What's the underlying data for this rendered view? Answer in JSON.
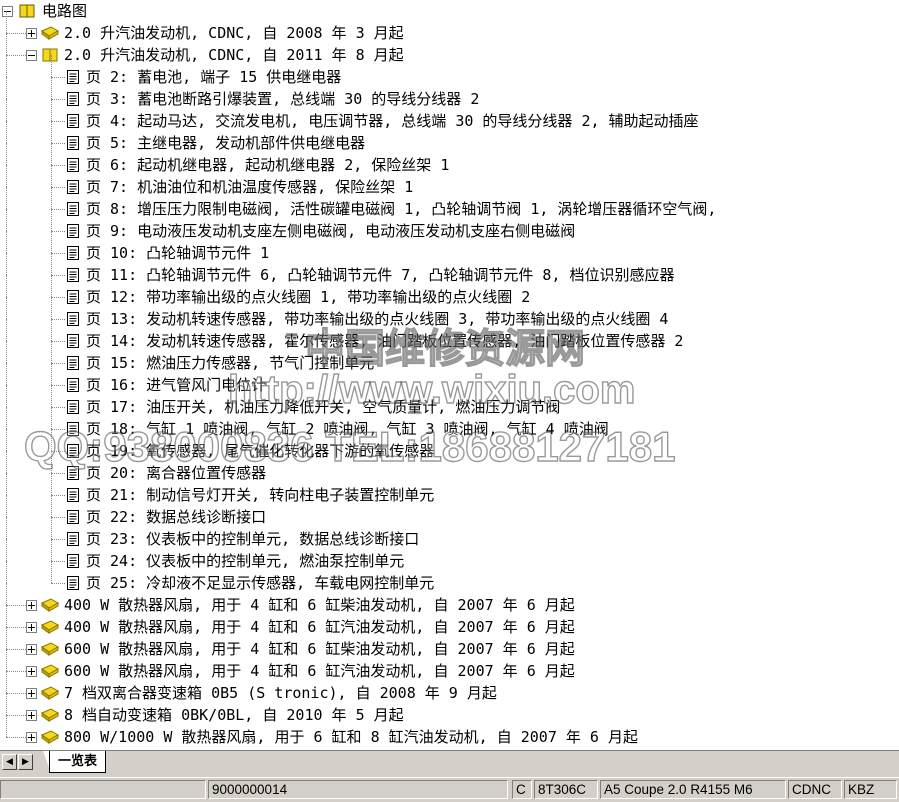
{
  "tree": {
    "root_label": "电路图",
    "items": [
      {
        "label": "2.0 升汽油发动机, CDNC, 自 2008 年 3 月起",
        "kind": "folder",
        "expanded": false,
        "level": 1
      },
      {
        "label": "2.0 升汽油发动机, CDNC, 自 2011 年 8 月起",
        "kind": "folder",
        "expanded": true,
        "level": 1
      },
      {
        "label": "页 2: 蓄电池, 端子 15 供电继电器",
        "kind": "page",
        "level": 2
      },
      {
        "label": "页 3: 蓄电池断路引爆装置, 总线端 30 的导线分线器 2",
        "kind": "page",
        "level": 2
      },
      {
        "label": "页 4: 起动马达, 交流发电机, 电压调节器, 总线端 30 的导线分线器 2, 辅助起动插座",
        "kind": "page",
        "level": 2
      },
      {
        "label": "页 5: 主继电器, 发动机部件供电继电器",
        "kind": "page",
        "level": 2
      },
      {
        "label": "页 6: 起动机继电器, 起动机继电器 2, 保险丝架 1",
        "kind": "page",
        "level": 2
      },
      {
        "label": "页 7: 机油油位和机油温度传感器, 保险丝架 1",
        "kind": "page",
        "level": 2
      },
      {
        "label": "页 8: 增压压力限制电磁阀, 活性碳罐电磁阀 1, 凸轮轴调节阀 1, 涡轮增压器循环空气阀,",
        "kind": "page",
        "level": 2
      },
      {
        "label": "页 9: 电动液压发动机支座左侧电磁阀, 电动液压发动机支座右侧电磁阀",
        "kind": "page",
        "level": 2
      },
      {
        "label": "页 10: 凸轮轴调节元件 1",
        "kind": "page",
        "level": 2
      },
      {
        "label": "页 11: 凸轮轴调节元件 6, 凸轮轴调节元件 7, 凸轮轴调节元件 8, 档位识别感应器",
        "kind": "page",
        "level": 2
      },
      {
        "label": "页 12: 带功率输出级的点火线圈 1, 带功率输出级的点火线圈 2",
        "kind": "page",
        "level": 2
      },
      {
        "label": "页 13: 发动机转速传感器, 带功率输出级的点火线圈 3, 带功率输出级的点火线圈 4",
        "kind": "page",
        "level": 2
      },
      {
        "label": "页 14: 发动机转速传感器, 霍尔传感器, 油门踏板位置传感器, 油门踏板位置传感器 2",
        "kind": "page",
        "level": 2
      },
      {
        "label": "页 15: 燃油压力传感器, 节气门控制单元",
        "kind": "page",
        "level": 2
      },
      {
        "label": "页 16: 进气管风门电位计",
        "kind": "page",
        "level": 2
      },
      {
        "label": "页 17: 油压开关, 机油压力降低开关, 空气质量计, 燃油压力调节阀",
        "kind": "page",
        "level": 2
      },
      {
        "label": "页 18: 气缸 1 喷油阀, 气缸 2 喷油阀, 气缸 3 喷油阀, 气缸 4 喷油阀",
        "kind": "page",
        "level": 2
      },
      {
        "label": "页 19: 氧传感器, 尾气催化转化器下游的氧传感器",
        "kind": "page",
        "level": 2
      },
      {
        "label": "页 20: 离合器位置传感器",
        "kind": "page",
        "level": 2
      },
      {
        "label": "页 21: 制动信号灯开关, 转向柱电子装置控制单元",
        "kind": "page",
        "level": 2
      },
      {
        "label": "页 22: 数据总线诊断接口",
        "kind": "page",
        "level": 2
      },
      {
        "label": "页 23: 仪表板中的控制单元, 数据总线诊断接口",
        "kind": "page",
        "level": 2
      },
      {
        "label": "页 24: 仪表板中的控制单元, 燃油泵控制单元",
        "kind": "page",
        "level": 2
      },
      {
        "label": "页 25: 冷却液不足显示传感器, 车载电网控制单元",
        "kind": "page",
        "level": 2
      },
      {
        "label": "400 W 散热器风扇, 用于 4 缸和 6 缸柴油发动机, 自 2007 年 6 月起",
        "kind": "folder",
        "expanded": false,
        "level": 1
      },
      {
        "label": "400 W 散热器风扇, 用于 4 缸和 6 缸汽油发动机, 自 2007 年 6 月起",
        "kind": "folder",
        "expanded": false,
        "level": 1
      },
      {
        "label": "600 W 散热器风扇, 用于 4 缸和 6 缸柴油发动机, 自 2007 年 6 月起",
        "kind": "folder",
        "expanded": false,
        "level": 1
      },
      {
        "label": "600 W 散热器风扇, 用于 4 缸和 6 缸汽油发动机, 自 2007 年 6 月起",
        "kind": "folder",
        "expanded": false,
        "level": 1
      },
      {
        "label": "7 档双离合器变速箱 0B5 (S tronic), 自 2008 年 9 月起",
        "kind": "folder",
        "expanded": false,
        "level": 1
      },
      {
        "label": "8 档自动变速箱 0BK/0BL, 自 2010 年 5 月起",
        "kind": "folder",
        "expanded": false,
        "level": 1
      },
      {
        "label": "800 W/1000 W 散热器风扇, 用于 6 缸和 8 缸汽油发动机, 自 2007 年 6 月起",
        "kind": "folder",
        "expanded": false,
        "level": 1
      }
    ]
  },
  "tab_label": "一览表",
  "status": {
    "code": "9000000014",
    "c": "C",
    "model_code": "8T306C",
    "model": "A5 Coupe 2.0 R4155 M6",
    "engine": "CDNC",
    "gearbox": "KBZ"
  },
  "watermark": {
    "line1": "中国维修资源网",
    "line2": "http://www.wixiu.com",
    "line3": "QQ:938000836   TEL:18688127181"
  },
  "colors": {
    "folder": "#f4d81c",
    "folder_edge": "#8a7200",
    "chrome": "#d4d0c8"
  }
}
